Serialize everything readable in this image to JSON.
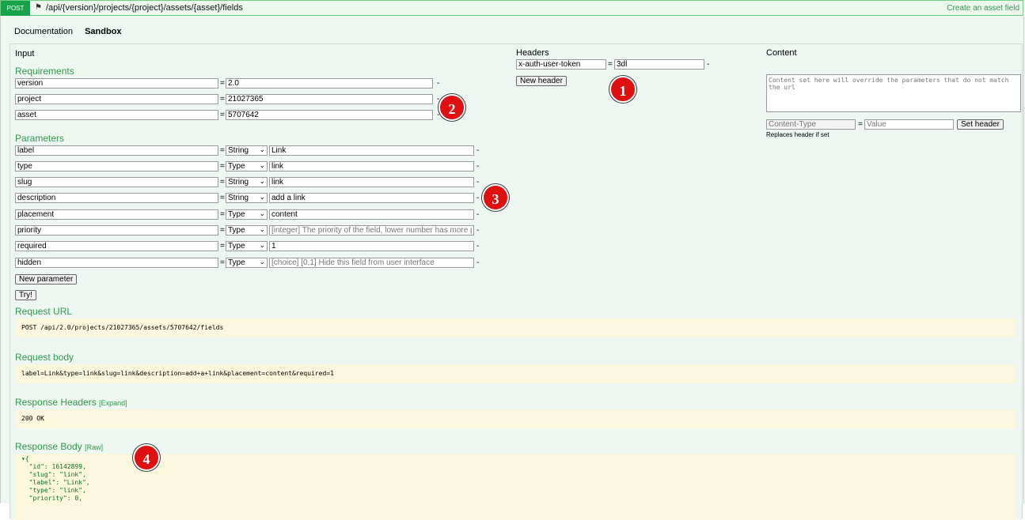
{
  "route": {
    "method": "POST",
    "icon": "route-icon",
    "path": "/api/{version}/projects/{project}/assets/{asset}/fields",
    "description": "Create an asset field"
  },
  "tabs": {
    "documentation": "Documentation",
    "sandbox": "Sandbox"
  },
  "input": {
    "title": "Input",
    "requirements_title": "Requirements",
    "requirements": [
      {
        "name": "version",
        "value": "2.0"
      },
      {
        "name": "project",
        "value": "21027365"
      },
      {
        "name": "asset",
        "value": "5707642"
      }
    ],
    "parameters_title": "Parameters",
    "parameters": [
      {
        "name": "label",
        "type": "String",
        "value": "Link",
        "placeholder": ""
      },
      {
        "name": "type",
        "type": "Type",
        "value": "link",
        "placeholder": ""
      },
      {
        "name": "slug",
        "type": "String",
        "value": "link",
        "placeholder": ""
      },
      {
        "name": "description",
        "type": "String",
        "value": "add a link",
        "placeholder": ""
      },
      {
        "name": "placement",
        "type": "Type",
        "value": "content",
        "placeholder": ""
      },
      {
        "name": "priority",
        "type": "Type",
        "value": "",
        "placeholder": "[integer] The priority of the field, lower number has more priority"
      },
      {
        "name": "required",
        "type": "Type",
        "value": "1",
        "placeholder": ""
      },
      {
        "name": "hidden",
        "type": "Type",
        "value": "",
        "placeholder": "[choice] [0,1] Hide this field from user interface"
      }
    ],
    "new_parameter": "New parameter",
    "try": "Try!",
    "equals": "=",
    "dash": "-"
  },
  "headers": {
    "title": "Headers",
    "name": "x-auth-user-token",
    "value": "3dl",
    "extra_value": "_",
    "new_header": "New header"
  },
  "content": {
    "title": "Content",
    "placeholder": "Content set here will override the parameters that do not match the url",
    "content_type_placeholder": "Content-Type",
    "value_placeholder": "Value",
    "set_header": "Set header",
    "note": "Replaces header if set"
  },
  "request_url": {
    "title": "Request URL",
    "value": "POST /api/2.0/projects/21027365/assets/5707642/fields"
  },
  "request_body": {
    "title": "Request body",
    "value": "label=Link&type=link&slug=link&description=add+a+link&placement=content&required=1"
  },
  "response_headers": {
    "title": "Response Headers",
    "expand": "[Expand]",
    "value": "200 OK"
  },
  "response_body": {
    "title": "Response Body",
    "raw": "[Raw]",
    "lines": [
      "▾{",
      "  \"id\": 16142899,",
      "  \"slug\": \"link\",",
      "  \"label\": \"Link\",",
      "  \"type\": \"link\",",
      "  \"priority\": 0,"
    ]
  },
  "badges": [
    "1",
    "2",
    "3",
    "4"
  ],
  "colors": {
    "accent_green": "#2f9a4a",
    "method_bg": "#17a34a",
    "code_bg": "#fbf7dc",
    "badge_red": "#e01010"
  }
}
